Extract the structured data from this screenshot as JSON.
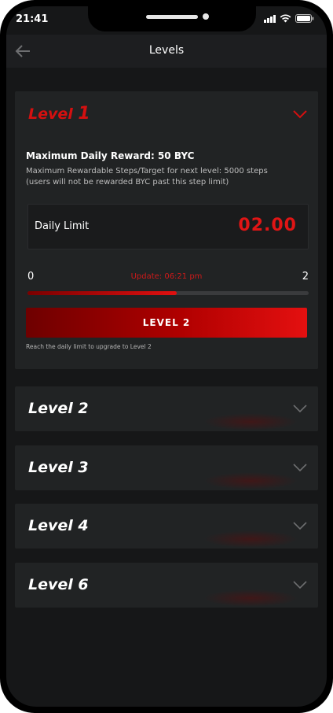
{
  "status_bar": {
    "time": "21:41"
  },
  "header": {
    "title": "Levels"
  },
  "levels": [
    {
      "title": "Level",
      "number": "1",
      "expanded": true,
      "max_daily_reward": "Maximum Daily Reward: 50 BYC",
      "steps_note": "Maximum Rewardable Steps/Target for next level: 5000 steps (users will not be rewarded BYC past this step limit)",
      "daily_limit_label": "Daily Limit",
      "daily_limit_value": "02.00",
      "range_min": "0",
      "range_max": "2",
      "update_text": "Update: 06:21 pm",
      "progress_percent": 53,
      "upgrade_button": "LEVEL 2",
      "hint": "Reach the daily limit to upgrade to Level 2"
    },
    {
      "title": "Level 2",
      "expanded": false
    },
    {
      "title": "Level 3",
      "expanded": false
    },
    {
      "title": "Level 4",
      "expanded": false
    },
    {
      "title": "Level 6",
      "expanded": false
    }
  ],
  "colors": {
    "accent": "#e01515",
    "background": "#161718",
    "card": "#212324"
  }
}
